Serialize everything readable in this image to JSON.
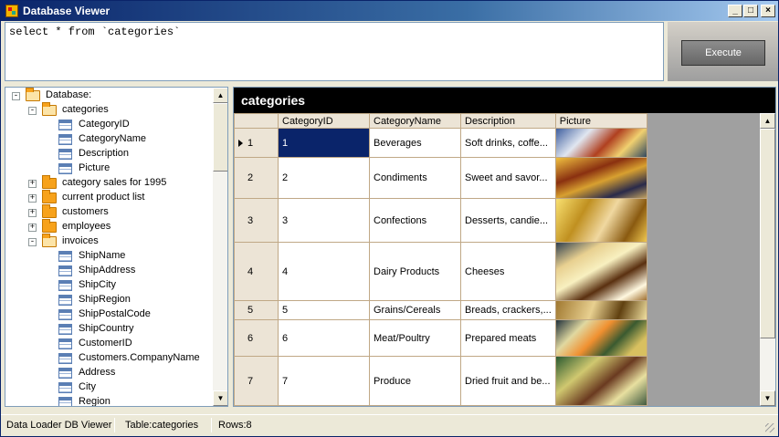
{
  "window": {
    "title": "Database Viewer",
    "min_label": "_",
    "max_label": "□",
    "close_label": "×"
  },
  "query": {
    "text": "select * from `categories`",
    "execute_label": "Execute"
  },
  "tree": {
    "root": "Database:",
    "items": [
      {
        "label": "categories",
        "expanded": true,
        "children": [
          "CategoryID",
          "CategoryName",
          "Description",
          "Picture"
        ]
      },
      {
        "label": "category sales for 1995",
        "expanded": false
      },
      {
        "label": "current product list",
        "expanded": false
      },
      {
        "label": "customers",
        "expanded": false
      },
      {
        "label": "employees",
        "expanded": false
      },
      {
        "label": "invoices",
        "expanded": true,
        "children": [
          "ShipName",
          "ShipAddress",
          "ShipCity",
          "ShipRegion",
          "ShipPostalCode",
          "ShipCountry",
          "CustomerID",
          "Customers.CompanyName",
          "Address",
          "City",
          "Region"
        ]
      }
    ]
  },
  "grid": {
    "title": "categories",
    "columns": [
      "CategoryID",
      "CategoryName",
      "Description",
      "Picture"
    ],
    "rows": [
      {
        "row": "1",
        "id": "1",
        "name": "Beverages",
        "desc": "Soft drinks, coffe...",
        "current": true
      },
      {
        "row": "2",
        "id": "2",
        "name": "Condiments",
        "desc": "Sweet and savor..."
      },
      {
        "row": "3",
        "id": "3",
        "name": "Confections",
        "desc": "Desserts, candie..."
      },
      {
        "row": "4",
        "id": "4",
        "name": "Dairy Products",
        "desc": "Cheeses"
      },
      {
        "row": "5",
        "id": "5",
        "name": "Grains/Cereals",
        "desc": "Breads, crackers,..."
      },
      {
        "row": "6",
        "id": "6",
        "name": "Meat/Poultry",
        "desc": "Prepared meats"
      },
      {
        "row": "7",
        "id": "7",
        "name": "Produce",
        "desc": "Dried fruit and be..."
      }
    ]
  },
  "status": {
    "app": "Data Loader DB Viewer",
    "table": "Table:categories",
    "rows": "Rows:8"
  },
  "colors": {
    "selection": "#0a246a",
    "grid_header": "#ece4d6",
    "title_bar": "#0a246a"
  }
}
